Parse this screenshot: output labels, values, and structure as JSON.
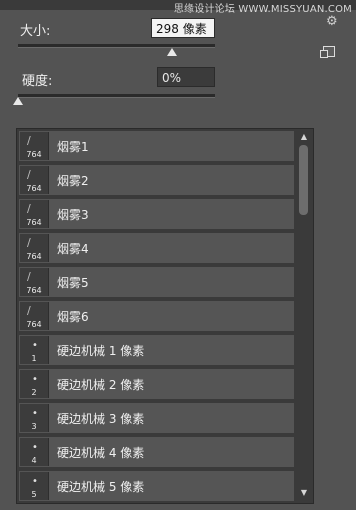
{
  "watermark": "思缘设计论坛 WWW.MISSYUAN.COM",
  "size": {
    "label": "大小:",
    "value": "298 像素",
    "slider_percent": 0.78
  },
  "hardness": {
    "label": "硬度:",
    "value": "0%",
    "slider_percent": 0.0
  },
  "brushes": [
    {
      "name": "烟雾1",
      "thumb_number": "764",
      "type": "stroke"
    },
    {
      "name": "烟雾2",
      "thumb_number": "764",
      "type": "stroke"
    },
    {
      "name": "烟雾3",
      "thumb_number": "764",
      "type": "stroke"
    },
    {
      "name": "烟雾4",
      "thumb_number": "764",
      "type": "stroke"
    },
    {
      "name": "烟雾5",
      "thumb_number": "764",
      "type": "stroke"
    },
    {
      "name": "烟雾6",
      "thumb_number": "764",
      "type": "stroke"
    },
    {
      "name": "硬边机械 1 像素",
      "thumb_number": "1",
      "type": "dot"
    },
    {
      "name": "硬边机械 2 像素",
      "thumb_number": "2",
      "type": "dot"
    },
    {
      "name": "硬边机械 3 像素",
      "thumb_number": "3",
      "type": "dot"
    },
    {
      "name": "硬边机械 4 像素",
      "thumb_number": "4",
      "type": "dot"
    },
    {
      "name": "硬边机械 5 像素",
      "thumb_number": "5",
      "type": "dot"
    }
  ],
  "icons": {
    "settings": "gear-icon",
    "new_preset": "new-preset-icon",
    "scroll_up": "arrow-up-icon",
    "scroll_down": "arrow-down-icon"
  }
}
